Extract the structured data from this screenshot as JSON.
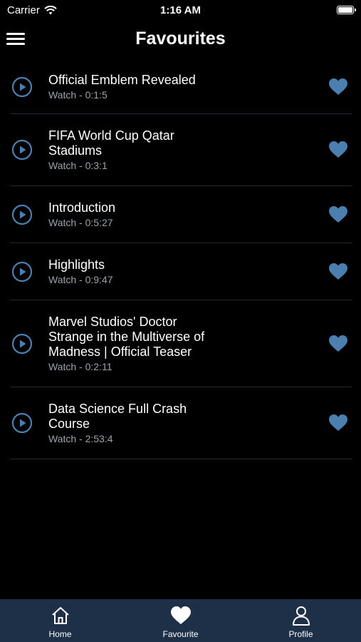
{
  "status_bar": {
    "carrier": "Carrier",
    "time": "1:16 AM"
  },
  "header": {
    "title": "Favourites"
  },
  "items": [
    {
      "title": "Official Emblem Revealed",
      "subtitle": "Watch - 0:1:5"
    },
    {
      "title": "FIFA World Cup Qatar Stadiums",
      "subtitle": "Watch - 0:3:1"
    },
    {
      "title": "Introduction",
      "subtitle": "Watch - 0:5:27"
    },
    {
      "title": "Highlights",
      "subtitle": "Watch - 0:9:47"
    },
    {
      "title": "Marvel Studios' Doctor Strange in the Multiverse of Madness | Official Teaser",
      "subtitle": "Watch - 0:2:11"
    },
    {
      "title": "Data Science Full Crash Course",
      "subtitle": "Watch - 2:53:4"
    }
  ],
  "tabbar": {
    "home": "Home",
    "favourite": "Favourite",
    "profile": "Profile"
  },
  "colors": {
    "accent": "#4a7fb0",
    "tabbar": "#1d3048",
    "background": "#000000"
  }
}
